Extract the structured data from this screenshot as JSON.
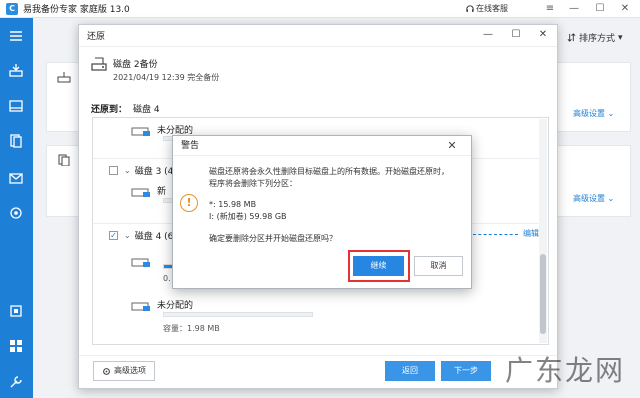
{
  "app": {
    "logo": "C",
    "title": "易我备份专家 家庭版 13.0",
    "online_service": "在线客服"
  },
  "icons": {
    "sidebar": [
      "menu-icon",
      "disk-backup-icon",
      "disk-icon",
      "file-icon",
      "mail-icon",
      "location-icon",
      "window-icon",
      "grid-icon",
      "tools-icon"
    ]
  },
  "colors": {
    "accent": "#1e7fd6",
    "warning": "#e8912d",
    "highlight": "#e23232"
  },
  "main": {
    "sort_label": "排序方式",
    "advanced_settings": "高级设置"
  },
  "restore_window": {
    "title": "还原",
    "backup_name": "磁盘 2备份",
    "backup_time": "2021/04/19 12:39 完全备份",
    "restore_to_label": "还原到：",
    "restore_to_value": "磁盘 4",
    "disks": [
      {
        "label": "磁盘 3 (40",
        "checked": false
      },
      {
        "label": "磁盘 4 (60",
        "checked": true
      }
    ],
    "partitions": {
      "top": {
        "name": "未分配的"
      },
      "disk3": {
        "name": "新"
      },
      "disk4": {
        "name": "",
        "size": "0."
      },
      "unallocated": {
        "name": "未分配的",
        "size": "容量：1.98 MB"
      }
    },
    "edit_link": "编辑",
    "advanced_options": "高级选项",
    "back": "返回",
    "next": "下一步"
  },
  "warning": {
    "title": "警告",
    "line1": "磁盘还原将会永久性删除目标磁盘上的所有数据。开始磁盘还原时，",
    "line2": "程序将会删除下列分区：",
    "part1": "*: 15.98 MB",
    "part2": "I: (新加卷) 59.98 GB",
    "confirm": "确定要删除分区并开始磁盘还原吗？",
    "continue": "继续",
    "cancel": "取消"
  },
  "watermark": "广东龙网"
}
